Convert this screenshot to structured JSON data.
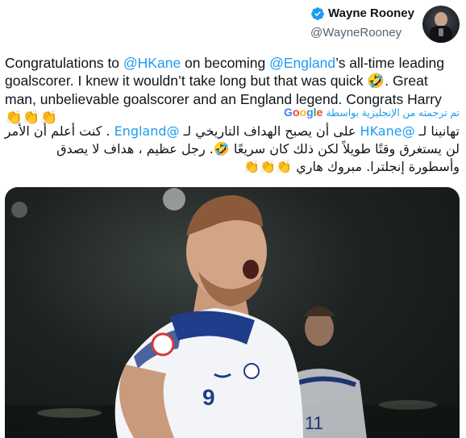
{
  "author": {
    "display_name": "Wayne Rooney",
    "handle": "@WayneRooney",
    "verified": true,
    "avatar_icon": "profile-photo"
  },
  "tweet": {
    "text_en": {
      "p1": "Congratulations to ",
      "mention1": "@HKane",
      "p2": " on becoming ",
      "mention2": "@England",
      "p3": "’s all-time leading goalscorer. I knew it wouldn’t take long but that was quick ",
      "emoji1": "🤣",
      "p4": ". Great man, unbelievable goalscorer and an England legend. Congrats Harry ",
      "emoji2": "👏👏👏"
    },
    "translation_label": "تم ترجمته من الإنجليزية بواسطة",
    "translation_provider": "Google",
    "text_ar": {
      "a1": "تهانينا لـ ",
      "mention1": "@HKane",
      "a2": " على أن يصبح الهداف التاريخي لـ ",
      "mention2": "@England",
      "a3": " . كنت أعلم أن الأمر لن يستغرق وقتًا طويلاً لكن ذلك كان سريعًا ",
      "emoji1": "🤣",
      "a4": ". رجل عظيم ، هداف لا يصدق وأسطورة إنجلترا. مبروك هاري ",
      "emoji2": "👏👏👏"
    }
  },
  "media": {
    "description_icon": "tweet-photo",
    "shirt_number_main": "9",
    "shirt_number_back": "11"
  },
  "colors": {
    "link": "#1d9bf0",
    "text": "#0f1419",
    "secondary": "#536471",
    "verified": "#1d9bf0"
  }
}
